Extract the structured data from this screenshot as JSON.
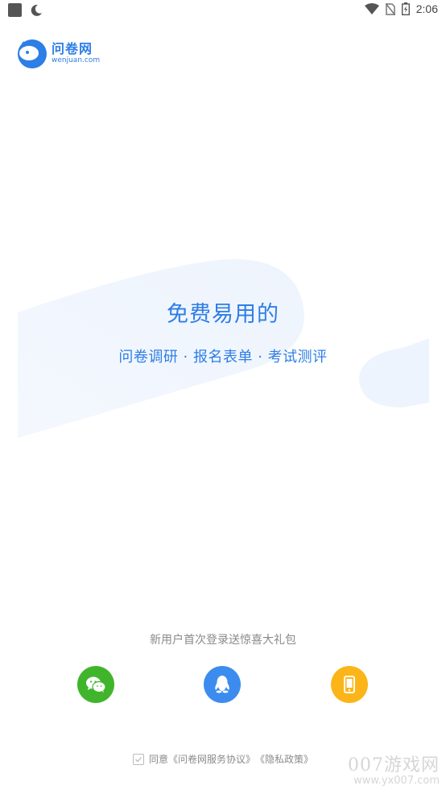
{
  "status_bar": {
    "time": "2:06"
  },
  "logo": {
    "name": "问卷网",
    "domain": "wenjuan.com"
  },
  "hero": {
    "headline": "免费易用的",
    "subline": "问卷调研 · 报名表单 · 考试测评"
  },
  "login": {
    "gift_note": "新用户首次登录送惊喜大礼包",
    "options": [
      {
        "name": "wechat",
        "icon": "wechat-icon",
        "color": "#40b52c"
      },
      {
        "name": "qq",
        "icon": "qq-icon",
        "color": "#3c8cf0"
      },
      {
        "name": "phone",
        "icon": "phone-icon",
        "color": "#fbb518"
      }
    ]
  },
  "agreement": {
    "prefix": "同意",
    "service": "《问卷网服务协议》",
    "privacy": "《隐私政策》"
  },
  "watermark": {
    "main": "007游戏网",
    "url": "www.yx007.com"
  },
  "colors": {
    "brand": "#2d7ee6",
    "wechat": "#40b52c",
    "qq": "#3c8cf0",
    "phone": "#fbb518"
  }
}
